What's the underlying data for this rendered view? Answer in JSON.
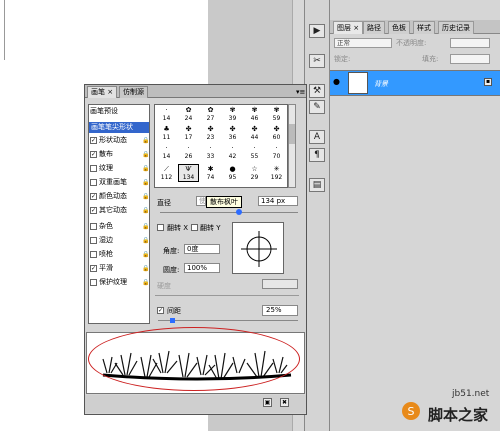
{
  "layers_panel": {
    "tabs": [
      "图层 ×",
      "路径",
      "色板",
      "样式",
      "历史记录"
    ],
    "blend_mode": "正常",
    "opacity_label": "不透明度:",
    "lock_label": "锁定:",
    "fill_label": "填充:",
    "layer_name": "背景",
    "icons": [
      "eye-icon",
      "lock-icon"
    ]
  },
  "tools": {
    "icons": [
      "play-icon",
      "tools-icon",
      "clone-icon",
      "brush-icon",
      "type-icon",
      "paragraph-icon",
      "panel-icon"
    ]
  },
  "brush_panel": {
    "tabs": [
      "画笔 ×",
      "仿制源"
    ],
    "menu_icon": "panel-menu-icon",
    "presets_title": "画笔预设",
    "options": [
      {
        "label": "画笔笔尖形状",
        "checked": false,
        "selected": true
      },
      {
        "label": "形状动态",
        "checked": true
      },
      {
        "label": "散布",
        "checked": true
      },
      {
        "label": "纹理",
        "checked": false
      },
      {
        "label": "双重画笔",
        "checked": false
      },
      {
        "label": "颜色动态",
        "checked": true
      },
      {
        "label": "其它动态",
        "checked": true
      },
      {
        "label": "杂色",
        "checked": false
      },
      {
        "label": "湿边",
        "checked": false
      },
      {
        "label": "喷枪",
        "checked": false
      },
      {
        "label": "平滑",
        "checked": true
      },
      {
        "label": "保护纹理",
        "checked": false
      }
    ],
    "brush_sizes": [
      [
        "14",
        "24",
        "27",
        "39",
        "46",
        "59"
      ],
      [
        "11",
        "17",
        "23",
        "36",
        "44",
        "60"
      ],
      [
        "14",
        "26",
        "33",
        "42",
        "55",
        "70"
      ],
      [
        "112",
        "134",
        "74",
        "95",
        "29",
        "192"
      ]
    ],
    "diameter_label": "直径",
    "diameter_value": "134 px",
    "use_sample_label": "使",
    "tooltip": "散布枫叶",
    "flip_x_label": "翻转 X",
    "flip_y_label": "翻转 Y",
    "angle_label": "角度:",
    "angle_value": "0度",
    "roundness_label": "圆度:",
    "roundness_value": "100%",
    "hardness_label": "硬度",
    "spacing_label": "间距",
    "spacing_checked": true,
    "spacing_value": "25%",
    "footer_icons": [
      "new-preset-icon",
      "delete-icon"
    ]
  },
  "watermark": {
    "url": "jb51.net",
    "name": "脚本之家"
  },
  "colors": {
    "layer_selected": "#3399ff",
    "highlight_oval": "#cc2222"
  }
}
